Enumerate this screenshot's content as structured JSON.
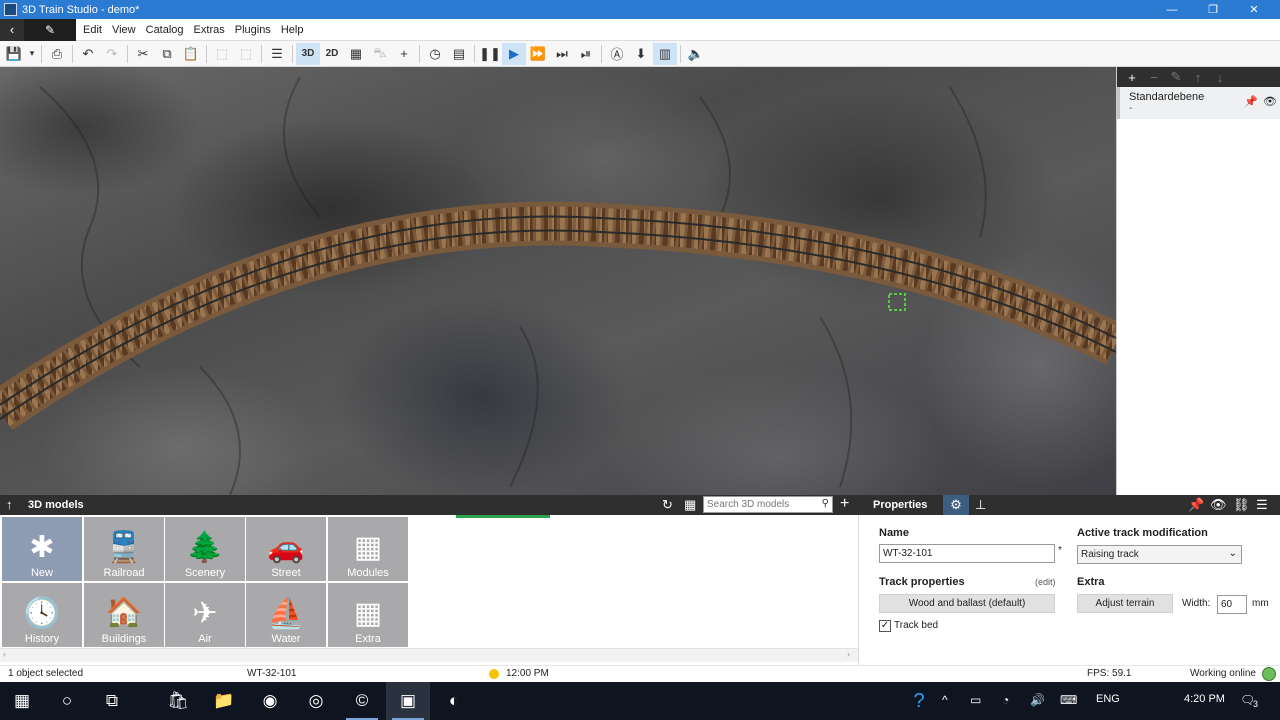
{
  "window": {
    "title": "3D Train Studio - demo*",
    "controls": [
      "—",
      "❐",
      "✕"
    ]
  },
  "menu": {
    "back": "‹",
    "edit_icon": "✎",
    "items": [
      "Edit",
      "View",
      "Catalog",
      "Extras",
      "Plugins",
      "Help"
    ]
  },
  "toolbar": {
    "mode_3d": "3D",
    "mode_2d": "2D"
  },
  "layers": {
    "name": "Standardebene",
    "sub": "-"
  },
  "bottom": {
    "left_title": "3D models",
    "search_placeholder": "Search 3D models",
    "right_title": "Properties"
  },
  "catalog": {
    "tiles": [
      {
        "label": "New",
        "icon": "✱"
      },
      {
        "label": "Railroad",
        "icon": "🚆"
      },
      {
        "label": "Scenery",
        "icon": "🌲"
      },
      {
        "label": "Street",
        "icon": "🚗"
      },
      {
        "label": "Modules",
        "icon": "▦"
      },
      {
        "label": "History",
        "icon": "🕓"
      },
      {
        "label": "Buildings",
        "icon": "🏠"
      },
      {
        "label": "Air",
        "icon": "✈"
      },
      {
        "label": "Water",
        "icon": "⛵"
      },
      {
        "label": "Extra",
        "icon": "▦"
      }
    ]
  },
  "properties": {
    "name_label": "Name",
    "name_value": "WT-32-101",
    "name_star": "*",
    "track_mod_label": "Active track modification",
    "track_mod_value": "Raising track",
    "track_props_label": "Track properties",
    "edit_link": "(edit)",
    "track_props_value": "Wood and ballast (default)",
    "track_bed_label": "Track bed",
    "track_bed_checked": true,
    "extra_label": "Extra",
    "adjust_terrain": "Adjust terrain",
    "width_label": "Width:",
    "width_value": "60",
    "width_unit": "mm"
  },
  "status": {
    "selection": "1 object selected",
    "object": "WT-32-101",
    "time": "12:00 PM",
    "fps": "FPS: 59.1",
    "online": "Working online"
  },
  "taskbar": {
    "lang": "ENG",
    "clock": "4:20 PM",
    "notifications": "3"
  }
}
